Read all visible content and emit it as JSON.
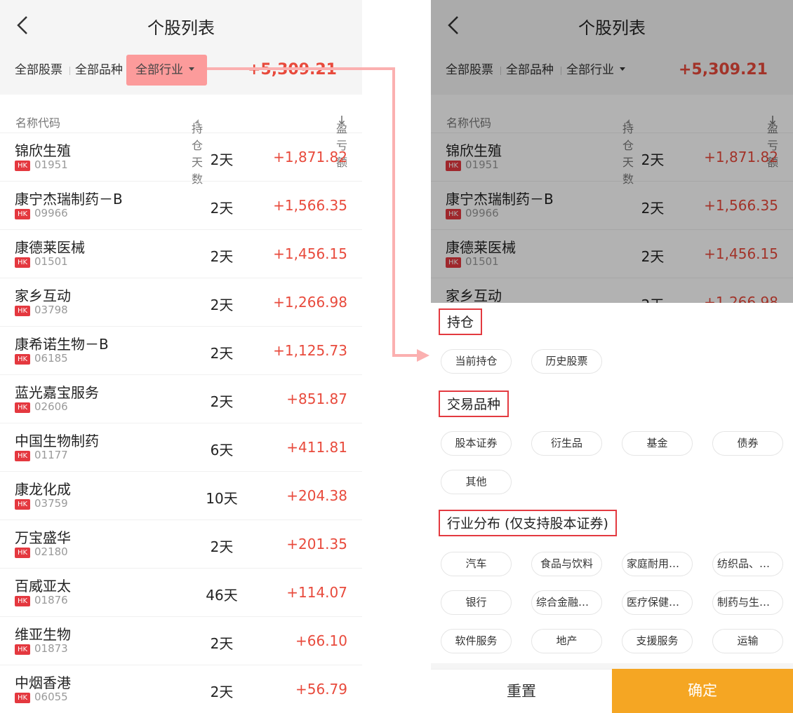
{
  "screen": {
    "title": "个股列表",
    "filters": [
      "全部股票",
      "全部品种",
      "全部行业"
    ],
    "total_pnl": "+5,309.21",
    "columns": {
      "name_code": "名称代码",
      "hold_days": "持仓天数",
      "pnl": "盈亏额"
    },
    "market_badge": "HK",
    "stocks": [
      {
        "name": "锦欣生殖",
        "code": "01951",
        "days": "2天",
        "pnl": "+1,871.82"
      },
      {
        "name": "康宁杰瑞制药－B",
        "code": "09966",
        "days": "2天",
        "pnl": "+1,566.35"
      },
      {
        "name": "康德莱医械",
        "code": "01501",
        "days": "2天",
        "pnl": "+1,456.15"
      },
      {
        "name": "家乡互动",
        "code": "03798",
        "days": "2天",
        "pnl": "+1,266.98"
      },
      {
        "name": "康希诺生物－B",
        "code": "06185",
        "days": "2天",
        "pnl": "+1,125.73"
      },
      {
        "name": "蓝光嘉宝服务",
        "code": "02606",
        "days": "2天",
        "pnl": "+851.87"
      },
      {
        "name": "中国生物制药",
        "code": "01177",
        "days": "6天",
        "pnl": "+411.81"
      },
      {
        "name": "康龙化成",
        "code": "03759",
        "days": "10天",
        "pnl": "+204.38"
      },
      {
        "name": "万宝盛华",
        "code": "02180",
        "days": "2天",
        "pnl": "+201.35"
      },
      {
        "name": "百威亚太",
        "code": "01876",
        "days": "46天",
        "pnl": "+114.07"
      },
      {
        "name": "维亚生物",
        "code": "01873",
        "days": "2天",
        "pnl": "+66.10"
      },
      {
        "name": "中烟香港",
        "code": "06055",
        "days": "2天",
        "pnl": "+56.79"
      }
    ]
  },
  "filter_panel": {
    "sections": [
      {
        "title": "持仓",
        "options": [
          "当前持仓",
          "历史股票"
        ]
      },
      {
        "title": "交易品种",
        "options": [
          "股本证券",
          "衍生品",
          "基金",
          "债券",
          "其他"
        ]
      },
      {
        "title": "行业分布 (仅支持股本证券)",
        "options": [
          "汽车",
          "食品与饮料",
          "家庭耐用消...",
          "纺织品、服...",
          "银行",
          "综合金融服务",
          "医疗保健设...",
          "制药与生物...",
          "软件服务",
          "地产",
          "支援服务",
          "运输"
        ]
      }
    ],
    "reset_label": "重置",
    "confirm_label": "确定"
  },
  "colors": {
    "accent_red": "#e84a3c",
    "highlight_pink": "#fc9b9b",
    "annotation_red": "#e33a40",
    "confirm_orange": "#f5a623"
  }
}
